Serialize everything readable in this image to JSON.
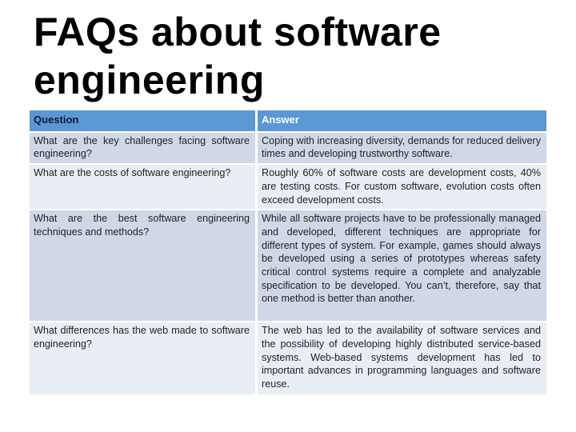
{
  "slide": {
    "title": "FAQs about software engineering"
  },
  "table": {
    "headers": {
      "question": "Question",
      "answer": "Answer"
    },
    "colors": {
      "header_bg": "#5b98d3",
      "row_dark": "#d0d8e7",
      "row_light": "#e9edf4"
    },
    "rows": [
      {
        "question": "What are the key challenges facing software engineering?",
        "answer": "Coping with increasing diversity, demands for reduced delivery times and developing trustworthy software."
      },
      {
        "question": "What are the costs of software engineering?",
        "answer": "Roughly 60% of software costs are development costs, 40% are testing costs. For custom software, evolution costs often exceed development costs."
      },
      {
        "question": "What are the best software engineering techniques and methods?",
        "answer": "While all software projects have to be professionally managed and developed, different techniques are appropriate for different types of system. For example, games should always be developed using a series of prototypes whereas safety critical control systems require a complete and analyzable specification to be developed. You can’t, therefore, say that one method is better than another."
      },
      {
        "question": "What differences has the web made to software engineering?",
        "answer": "The web has led to the availability of software services and the possibility of developing highly distributed service-based systems. Web-based systems development has led to important advances in programming languages and software reuse."
      }
    ]
  }
}
